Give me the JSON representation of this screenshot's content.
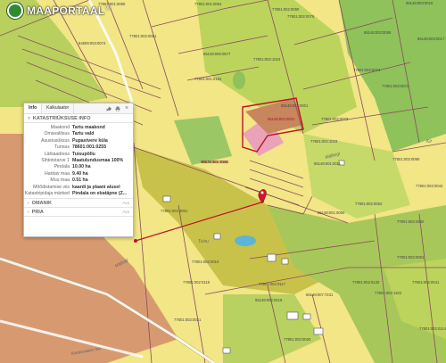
{
  "app": {
    "logo_text": "MAAPORTAAL",
    "logo_mark": "®"
  },
  "panel": {
    "tabs": [
      "Info",
      "Kalkulaator"
    ],
    "tools": [
      "like-icon",
      "print-icon",
      "close-icon"
    ],
    "close_glyph": "×",
    "section_main": "KATASTRIÜKSUSE INFO",
    "rows": [
      {
        "key": "Maakond",
        "value": "Tartu maakond"
      },
      {
        "key": "Omavalitsus",
        "value": "Tartu vald"
      },
      {
        "key": "Asustusüksus",
        "value": "Pupastvere küla"
      },
      {
        "key": "Tunnus",
        "value": "78601:001:0255"
      },
      {
        "key": "Lähiaadress",
        "value": "Tuisupõllu"
      },
      {
        "key": "Sihtotstarve 1",
        "value": "Maatulundusmaa 100%"
      },
      {
        "key": "Pindala",
        "value": "10.00 ha"
      },
      {
        "key": "Haritav maa",
        "value": "9.40 ha"
      },
      {
        "key": "Muu maa",
        "value": "0.51 ha"
      },
      {
        "key": "Mõõdistamise viis",
        "value": "kaardi ja plaani alusel"
      },
      {
        "key": "Katastripidaja märked",
        "value": "Pindala on ebatäpne (Z..."
      }
    ],
    "section_owner": "OMANIK",
    "section_pria": "PRIA",
    "more_label": "Ava",
    "chevron_collapsed": "›",
    "chevron_expanded": "˅"
  },
  "map": {
    "parcel_labels": [
      "77801:001:0080",
      "77801:001:0064",
      "77801:002:0090",
      "65148:003:0016",
      "77801:002:0076",
      "77801:002:0051",
      "64809:003:0074",
      "65148:003:0098",
      "65148:003:0017",
      "65148:006:0577",
      "77801:002:1024",
      "77801:002:0074",
      "77801:001:0182",
      "77801:002:0072",
      "65148:001:0001",
      "77801:002:0073",
      "65148:001:0083",
      "77801:002:1023",
      "65148:001:0011",
      "77801:002:0090",
      "77801:002:0043",
      "65148:001:0050",
      "77801:002:0260",
      "77801:001:0001",
      "77801:002:0091",
      "77801:002:0010",
      "77801:002:0119",
      "65148:002:0218",
      "65148:007:7231",
      "77801:002:0020",
      "77801:002:0021",
      "77801:002:1103",
      "77801:002:0041",
      "77801:002:0130",
      "77801:002:0117",
      "77801:002:0114",
      "77801:002:0062"
    ],
    "red_labels": [
      "65148:002:0001",
      "65148:001:0260"
    ],
    "road_labels": [
      "Mälingi",
      "Mällingi",
      "Karassaare tee",
      "Tuisu",
      "Kir"
    ],
    "colors": {
      "residential_yellow": "#f2e686",
      "agri_green": "#bfd25a",
      "forest_green": "#8fc25a",
      "olive": "#c8c247",
      "brown": "#d79a70",
      "selected_outline": "#c0102a",
      "route_line": "#c0102a"
    }
  }
}
